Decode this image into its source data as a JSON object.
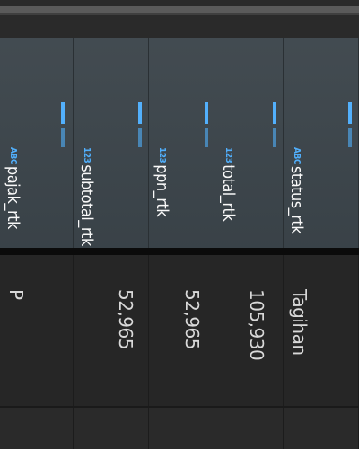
{
  "columns": [
    {
      "badge": "ABC",
      "label": "pajak_rtk"
    },
    {
      "badge": "123",
      "label": "subtotal_rtk"
    },
    {
      "badge": "123",
      "label": "ppn_rtk"
    },
    {
      "badge": "123",
      "label": "total_rtk"
    },
    {
      "badge": "ABC",
      "label": "status_rtk"
    }
  ],
  "row": {
    "pajak_rtk": "P",
    "subtotal_rtk": "52,965",
    "ppn_rtk": "52,965",
    "total_rtk": "105,930",
    "status_rtk": "Tagihan"
  },
  "colors": {
    "header_bg": "#3b444a",
    "badge": "#4fb0ff",
    "cell_text": "#d9d9d9",
    "row_bg": "#262626"
  }
}
